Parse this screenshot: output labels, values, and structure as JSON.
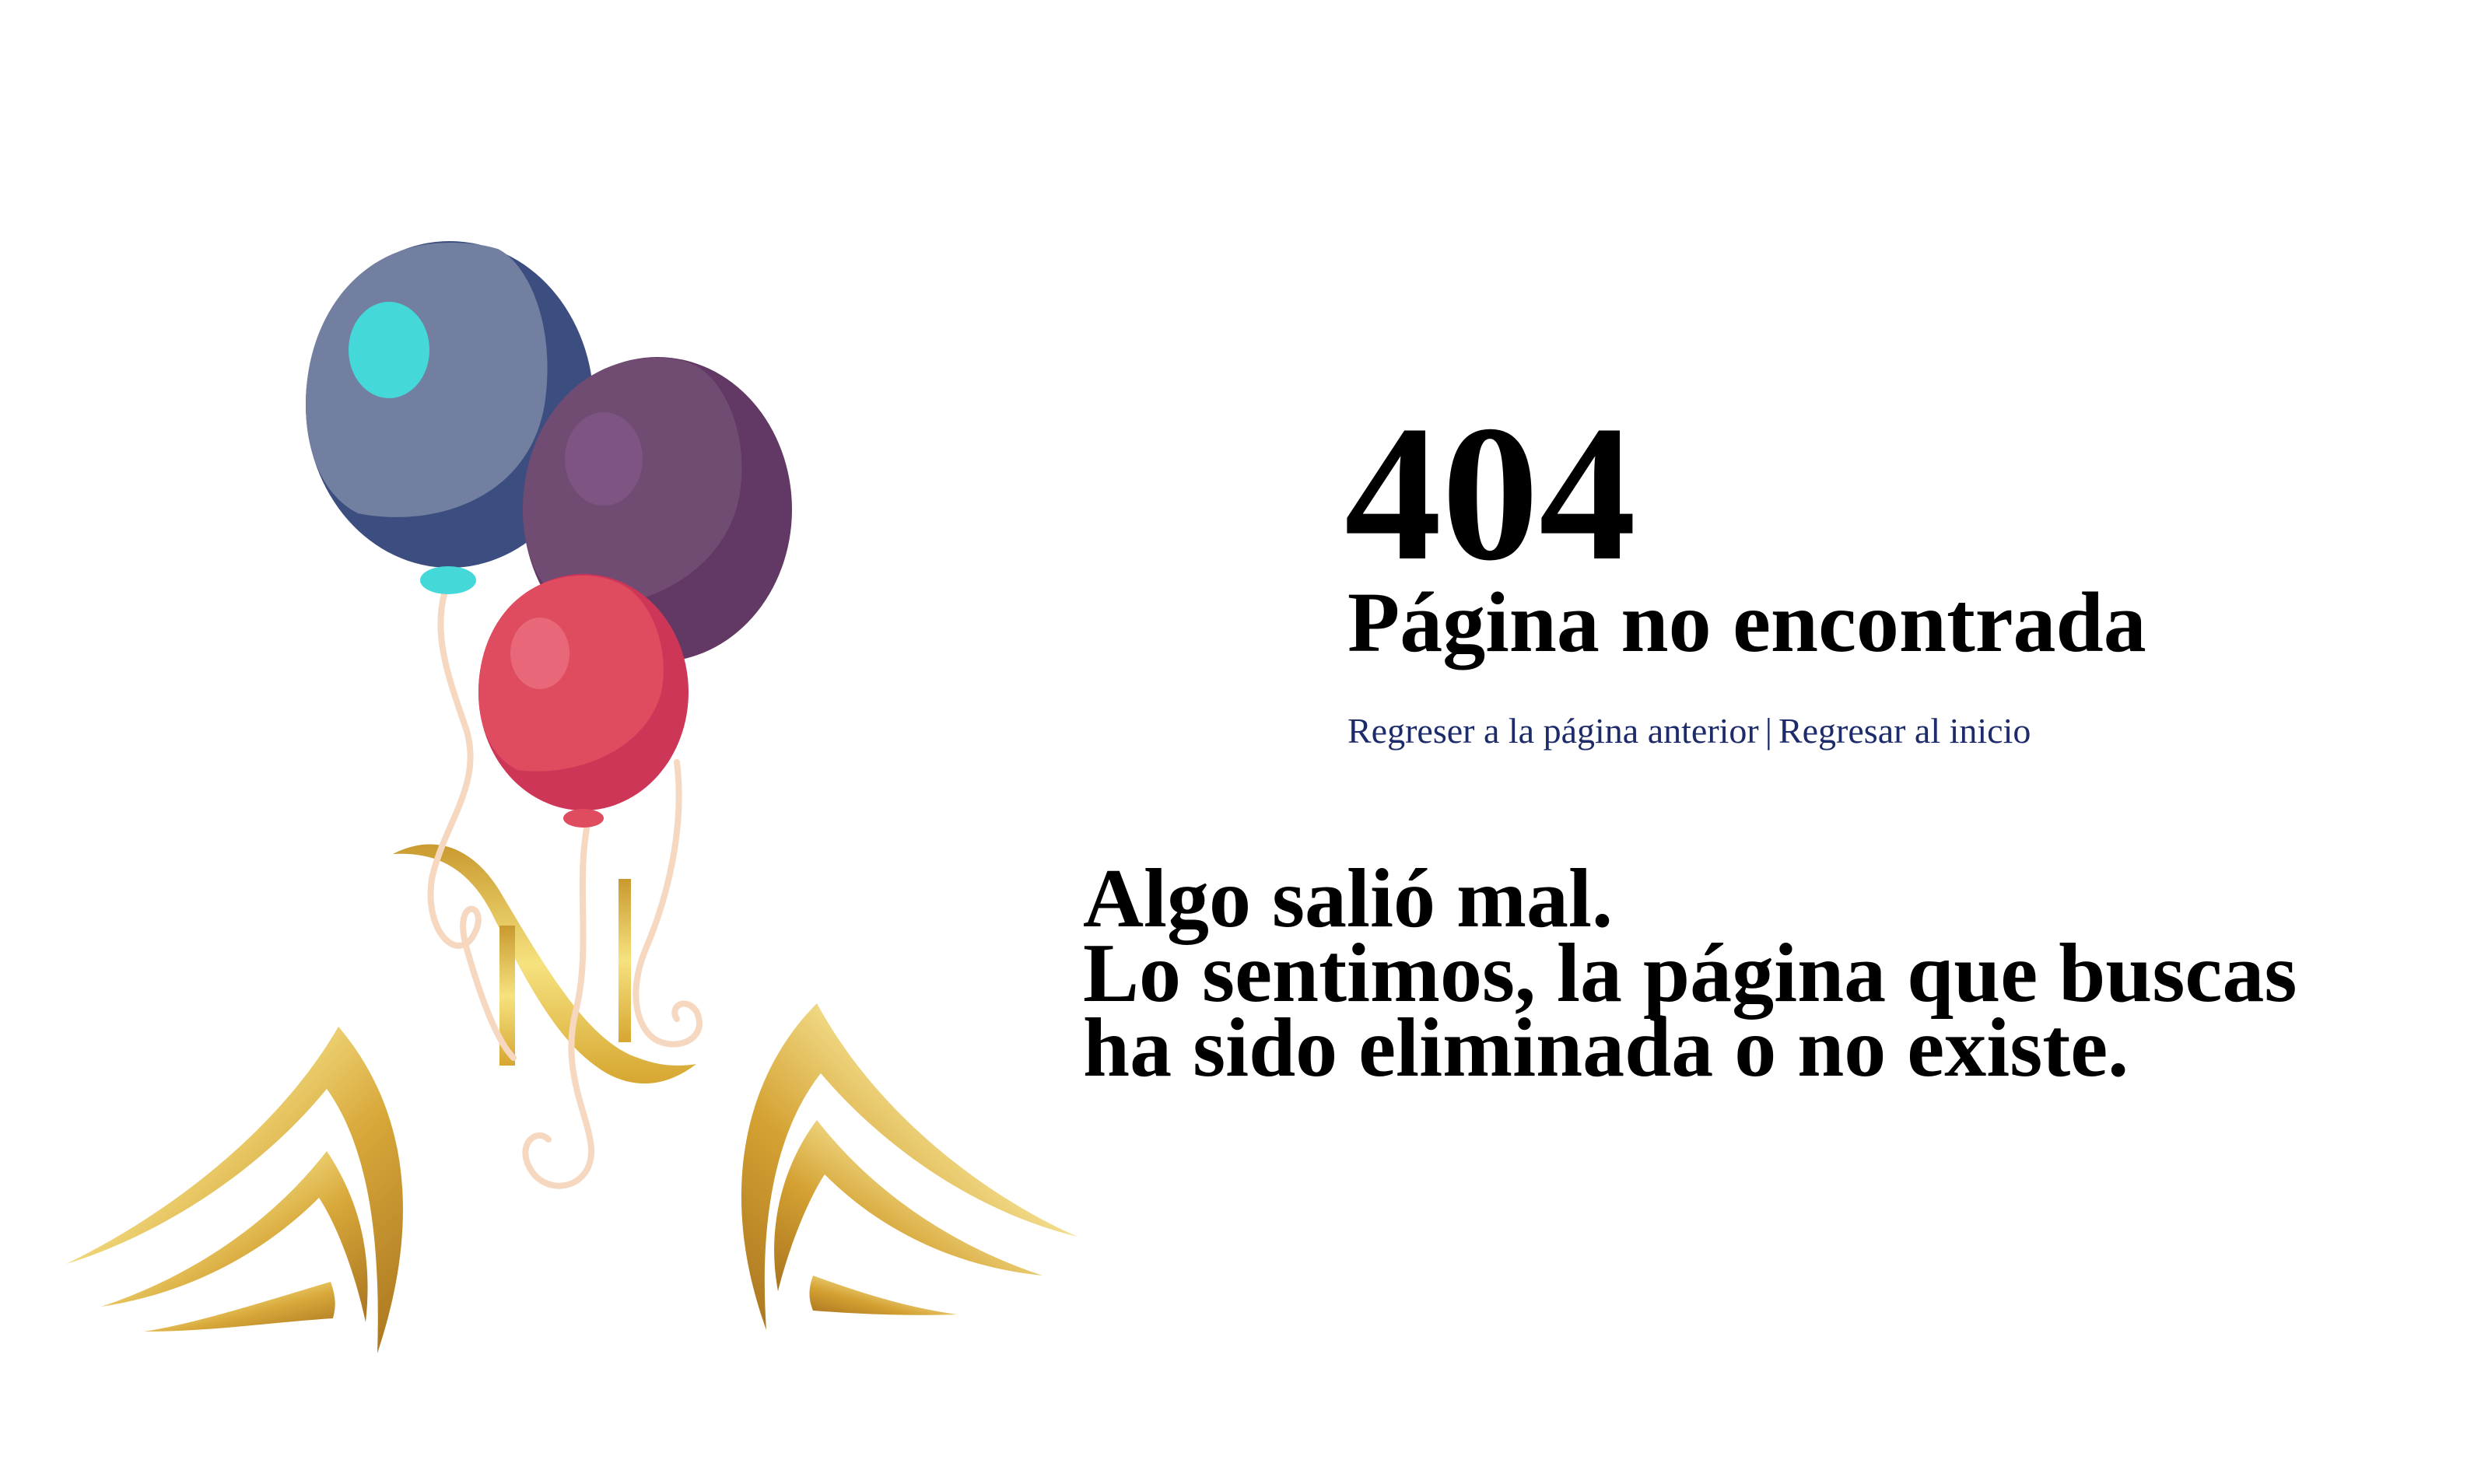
{
  "error": {
    "code": "404",
    "title": "Página no encontrada"
  },
  "navigation": {
    "back_label": "Regreser a la página anterior",
    "separator": "|",
    "home_label": "Regresar al inicio"
  },
  "message": {
    "line1": "Algo salió mal.",
    "line2": "Lo sentimos, la página que buscas",
    "line3": "ha sido eliminada o no existe."
  },
  "colors": {
    "link": "#1d2b6b",
    "text": "#000000",
    "gold": "#d4a93a",
    "balloon_blue": "#737fa0",
    "balloon_purple": "#704b72",
    "balloon_red": "#df4b5f"
  },
  "icons": {
    "balloons": "balloons-illustration",
    "logo": "gold-n-logo"
  }
}
